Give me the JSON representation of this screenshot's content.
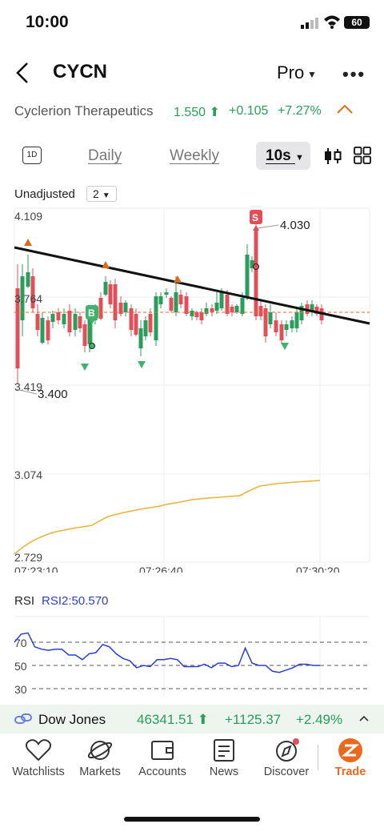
{
  "status": {
    "time": "10:00",
    "battery": "60"
  },
  "header": {
    "ticker": "CYCN",
    "mode": "Pro"
  },
  "quote": {
    "company": "Cyclerion Therapeutics",
    "price": "1.550",
    "change": "+0.105",
    "change_pct": "+7.27%"
  },
  "toolbar": {
    "btn_1d": "1D",
    "tabs": [
      "Daily",
      "Weekly"
    ],
    "active_interval": "10s"
  },
  "adjust": {
    "label": "Unadjusted",
    "value": "2"
  },
  "chart_data": {
    "type": "candlestick",
    "y_ticks": [
      "4.109",
      "3.764",
      "3.419",
      "3.074",
      "2.729"
    ],
    "x_ticks": [
      "07:23:10",
      "07:26:40",
      "07:30:20"
    ],
    "high_label": "4.030",
    "low_label": "3.400",
    "markers": [
      "B",
      "S"
    ],
    "ylim": [
      2.729,
      4.109
    ]
  },
  "rsi": {
    "label": "RSI",
    "value_label": "RSI2:50.570",
    "levels": [
      "70",
      "50",
      "30"
    ],
    "values": [
      70,
      77,
      78,
      66,
      64,
      63,
      64,
      64,
      59,
      59,
      55,
      60,
      61,
      68,
      66,
      60,
      56,
      54,
      48,
      50,
      49,
      55,
      55,
      56,
      55,
      49,
      49,
      49,
      51,
      48,
      52,
      52,
      49,
      50,
      65,
      52,
      50,
      50,
      45,
      44,
      46,
      48,
      51,
      51,
      50,
      50
    ]
  },
  "dow": {
    "name": "Dow Jones",
    "value": "46341.51",
    "change": "+1125.37",
    "pct": "+2.49%"
  },
  "nav": {
    "items": [
      "Watchlists",
      "Markets",
      "Accounts",
      "News",
      "Discover",
      "Trade"
    ]
  },
  "colors": {
    "up": "#2a9d5c",
    "down": "#e0505a",
    "accent": "#e86a1f"
  }
}
